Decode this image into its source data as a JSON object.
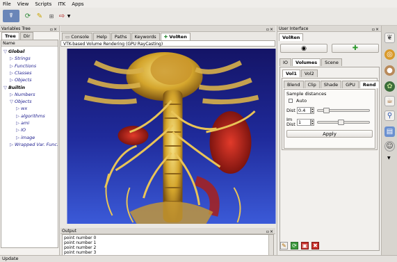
{
  "menu": [
    "File",
    "View",
    "Scripts",
    "ITK",
    "Apps"
  ],
  "left_panel": {
    "title": "Variables Tree",
    "tabs": [
      "Tree",
      "Dir"
    ],
    "column_header": "Name",
    "items": [
      {
        "label": "Global",
        "level": 0,
        "arrow": "▽",
        "bold": true
      },
      {
        "label": "Strings",
        "level": 1,
        "arrow": "▷"
      },
      {
        "label": "Functions",
        "level": 1,
        "arrow": "▷"
      },
      {
        "label": "Classes",
        "level": 1,
        "arrow": "▷"
      },
      {
        "label": "Objects",
        "level": 1,
        "arrow": "▷"
      },
      {
        "label": "Builtin",
        "level": 0,
        "arrow": "▽",
        "bold": true
      },
      {
        "label": "Numbers",
        "level": 1,
        "arrow": "▷"
      },
      {
        "label": "Objects",
        "level": 1,
        "arrow": "▽"
      },
      {
        "label": "wx",
        "level": 2,
        "arrow": "▷"
      },
      {
        "label": "algorithms",
        "level": 2,
        "arrow": "▷"
      },
      {
        "label": "ami",
        "level": 2,
        "arrow": "▷"
      },
      {
        "label": "IO",
        "level": 2,
        "arrow": "▷"
      },
      {
        "label": "image",
        "level": 2,
        "arrow": "▷"
      },
      {
        "label": "Wrapped Var. Func.",
        "level": 1,
        "arrow": "▷"
      }
    ]
  },
  "center": {
    "tabs": [
      "Console",
      "Help",
      "Paths",
      "Keywords",
      "VolRen"
    ],
    "active_tab": "VolRen",
    "view_title": "VTK-based Volume Rendering (GPU RayCasting)"
  },
  "output": {
    "title": "Output",
    "lines": [
      "point number 0",
      "point number 1",
      "point number 2",
      "point number 3"
    ]
  },
  "right_panel": {
    "title": "User Interface",
    "module_tab": "VolRen",
    "main_tabs": [
      "IO",
      "Volumes",
      "Scene"
    ],
    "vol_tabs": [
      "Vol1",
      "Vol2"
    ],
    "sub_tabs": [
      "Blend",
      "Clip",
      "Shade",
      "GPU",
      "Rend"
    ],
    "group_label": "Sample distances",
    "auto_label": "Auto",
    "auto_checked": false,
    "dist_label": "Dist",
    "dist_value": "0.4",
    "dist_slider": 0.12,
    "im_dist_label": "Im Dist",
    "im_dist_value": "1",
    "im_dist_slider": 0.45,
    "apply_label": "Apply"
  },
  "status": "Update"
}
